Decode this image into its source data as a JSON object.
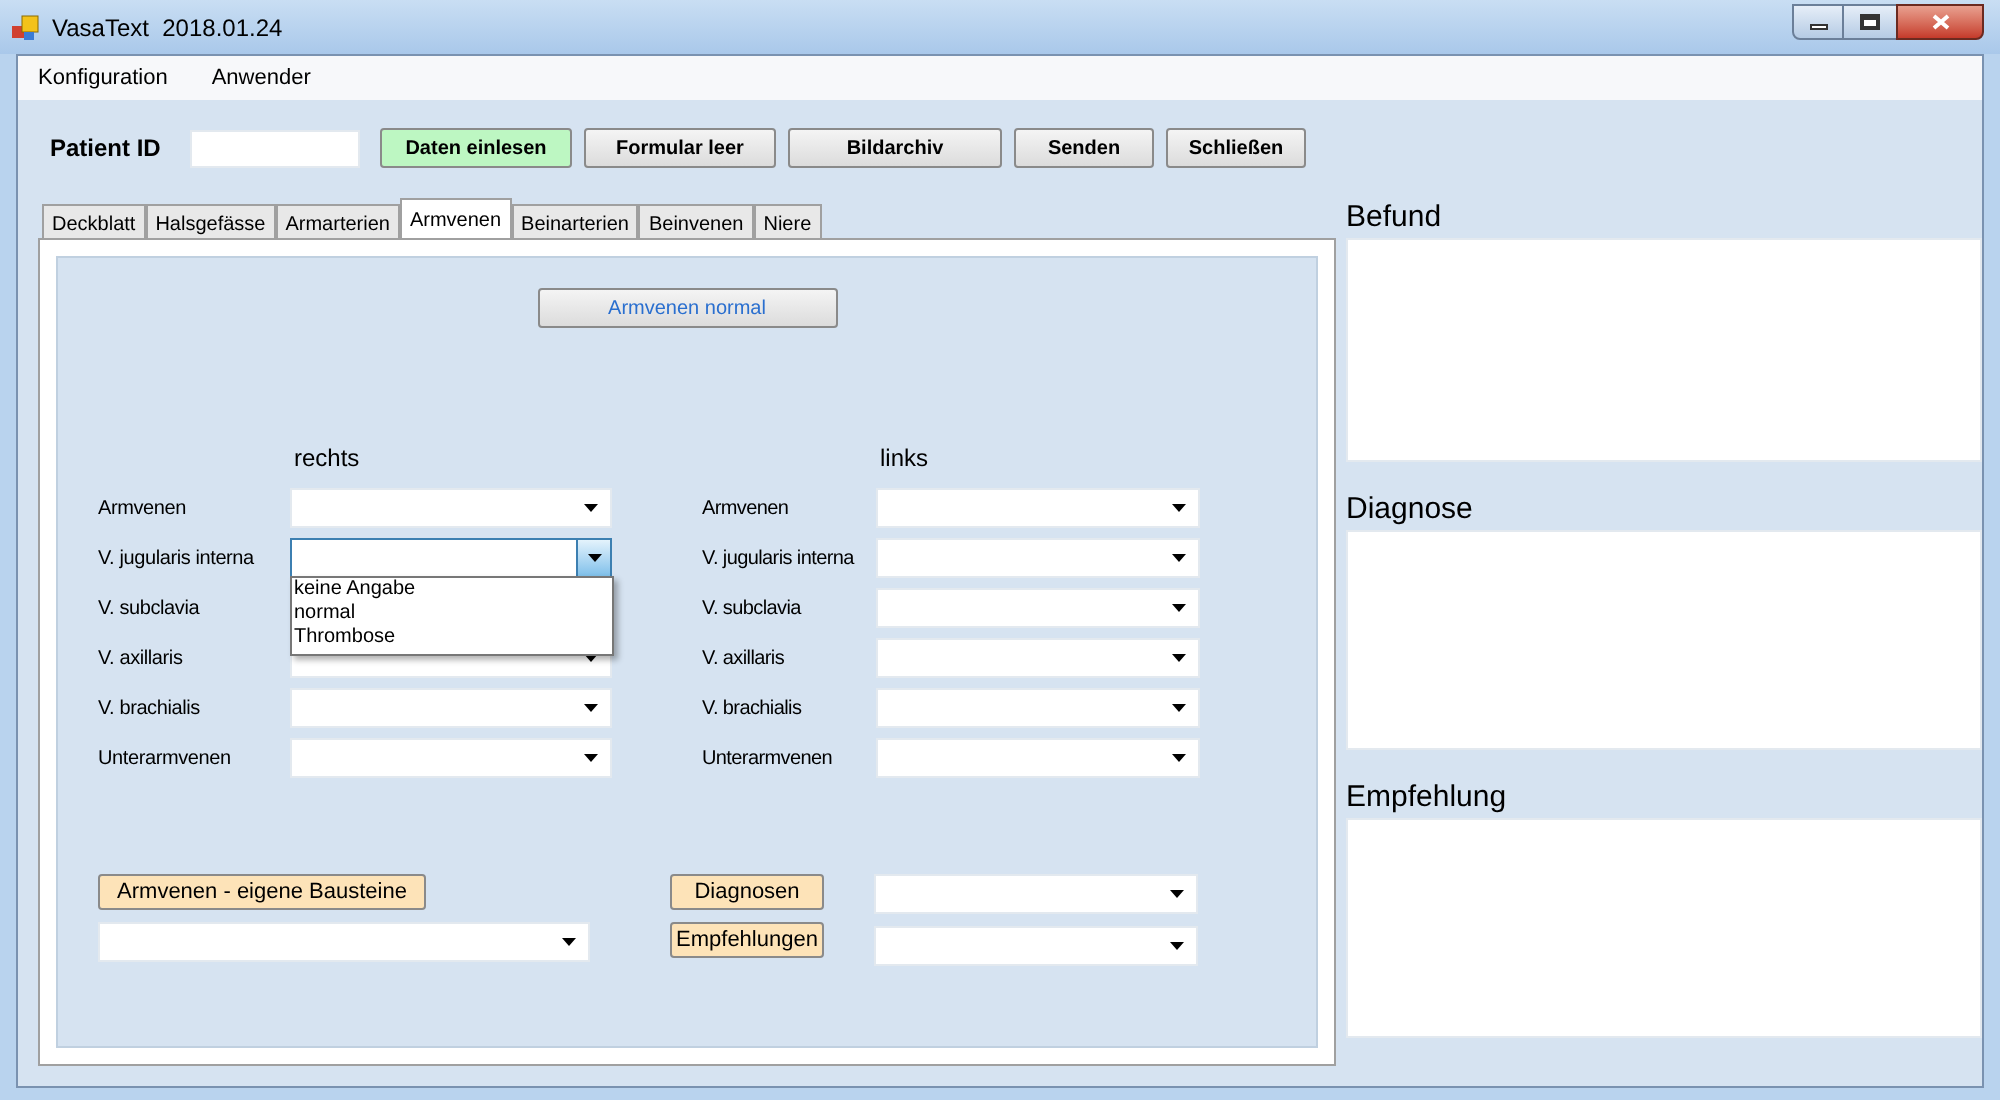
{
  "window": {
    "title": "VasaText  2018.01.24"
  },
  "menu": [
    "Konfiguration",
    "Anwender"
  ],
  "patient_id": {
    "label": "Patient ID"
  },
  "toolbar_buttons": [
    {
      "label": "Daten einlesen",
      "highlighted": true
    },
    {
      "label": "Formular leer",
      "highlighted": false
    },
    {
      "label": "Bildarchiv",
      "highlighted": false
    },
    {
      "label": "Senden",
      "highlighted": false
    },
    {
      "label": "Schließen",
      "highlighted": false
    }
  ],
  "tabs": [
    {
      "label": "Deckblatt",
      "selected": false
    },
    {
      "label": "Halsgefässe",
      "selected": false
    },
    {
      "label": "Armarterien",
      "selected": false
    },
    {
      "label": "Armvenen",
      "selected": true
    },
    {
      "label": "Beinarterien",
      "selected": false
    },
    {
      "label": "Beinvenen",
      "selected": false
    },
    {
      "label": "Niere",
      "selected": false
    }
  ],
  "normal_button": "Armvenen normal",
  "column_headings": [
    "rechts",
    "links"
  ],
  "rows": [
    {
      "rechts_label": "Armvenen",
      "rechts_expanded": false,
      "links_label": "Armvenen"
    },
    {
      "rechts_label": "V. jugularis interna",
      "rechts_expanded": true,
      "options": [
        "keine Angabe",
        "normal",
        "Thrombose"
      ],
      "links_label": "V. jugularis interna"
    },
    {
      "rechts_label": "V. subclavia",
      "rechts_expanded": false,
      "links_label": "V. subclavia"
    },
    {
      "rechts_label": "V. axillaris",
      "rechts_expanded": false,
      "links_label": "V. axillaris"
    },
    {
      "rechts_label": "V. brachialis",
      "rechts_expanded": false,
      "links_label": "V. brachialis"
    },
    {
      "rechts_label": "Unterarmvenen",
      "rechts_expanded": false,
      "links_label": "Unterarmvenen"
    }
  ],
  "bottom": {
    "bausteine_button": "Armvenen - eigene Bausteine",
    "diagnosen_button": "Diagnosen",
    "empfehlungen_button": "Empfehlungen"
  },
  "side_panels": [
    {
      "title": "Befund"
    },
    {
      "title": "Diagnose"
    },
    {
      "title": "Empfehlung"
    }
  ]
}
